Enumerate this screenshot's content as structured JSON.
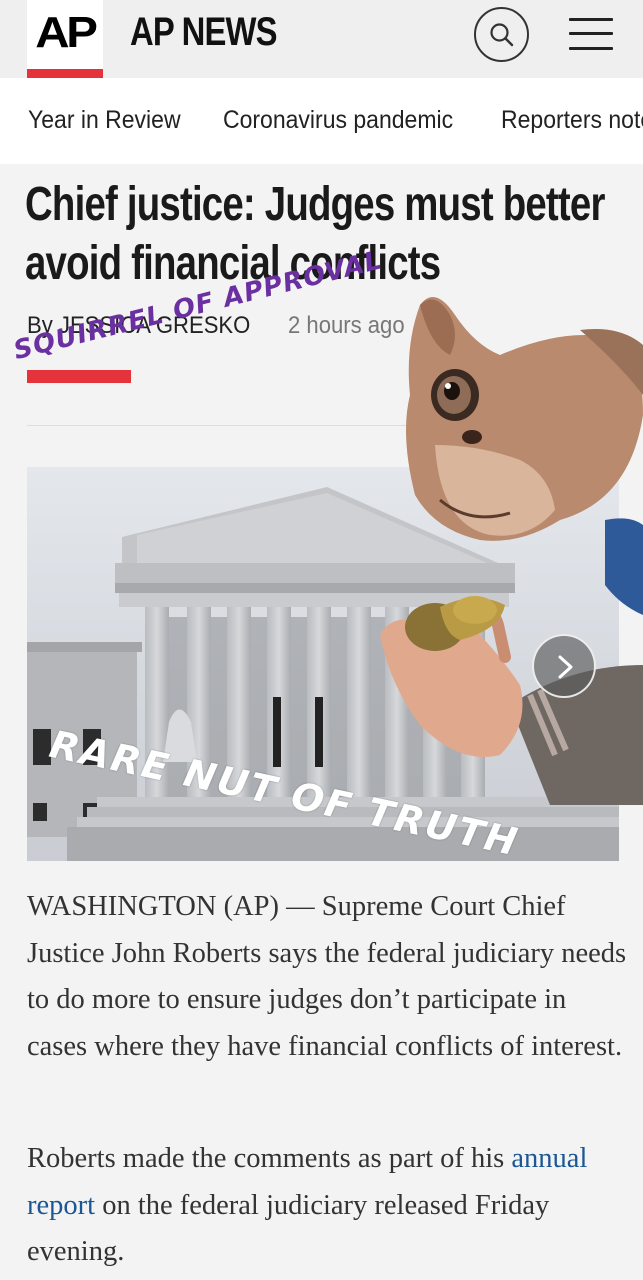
{
  "header": {
    "logo_text": "AP",
    "brand": "AP NEWS"
  },
  "nav": {
    "items": [
      "Year in Review",
      "Coronavirus pandemic",
      "Reporters notebook"
    ]
  },
  "article": {
    "headline": "Chief justice: Judges must better avoid financial conflicts",
    "byline": "By JESSICA GRESKO",
    "timestamp": "2 hours ago",
    "paragraphs": [
      {
        "text": "WASHINGTON (AP) — Supreme Court Chief Justice John Roberts says the federal judiciary needs to do more to ensure judges don’t participate in cases where they have financial conflicts of interest."
      },
      {
        "before": "Roberts made the comments as part of his ",
        "link": "annual report",
        "after": " on the federal judiciary released Friday evening."
      }
    ]
  },
  "annotations": {
    "top": "SQUIRREL OF APPROVAL",
    "photo": "RARE NUT OF TRUTH"
  },
  "colors": {
    "accent_red": "#e5333b",
    "link_blue": "#1b5794",
    "annotation_purple": "#6a2fa0"
  }
}
